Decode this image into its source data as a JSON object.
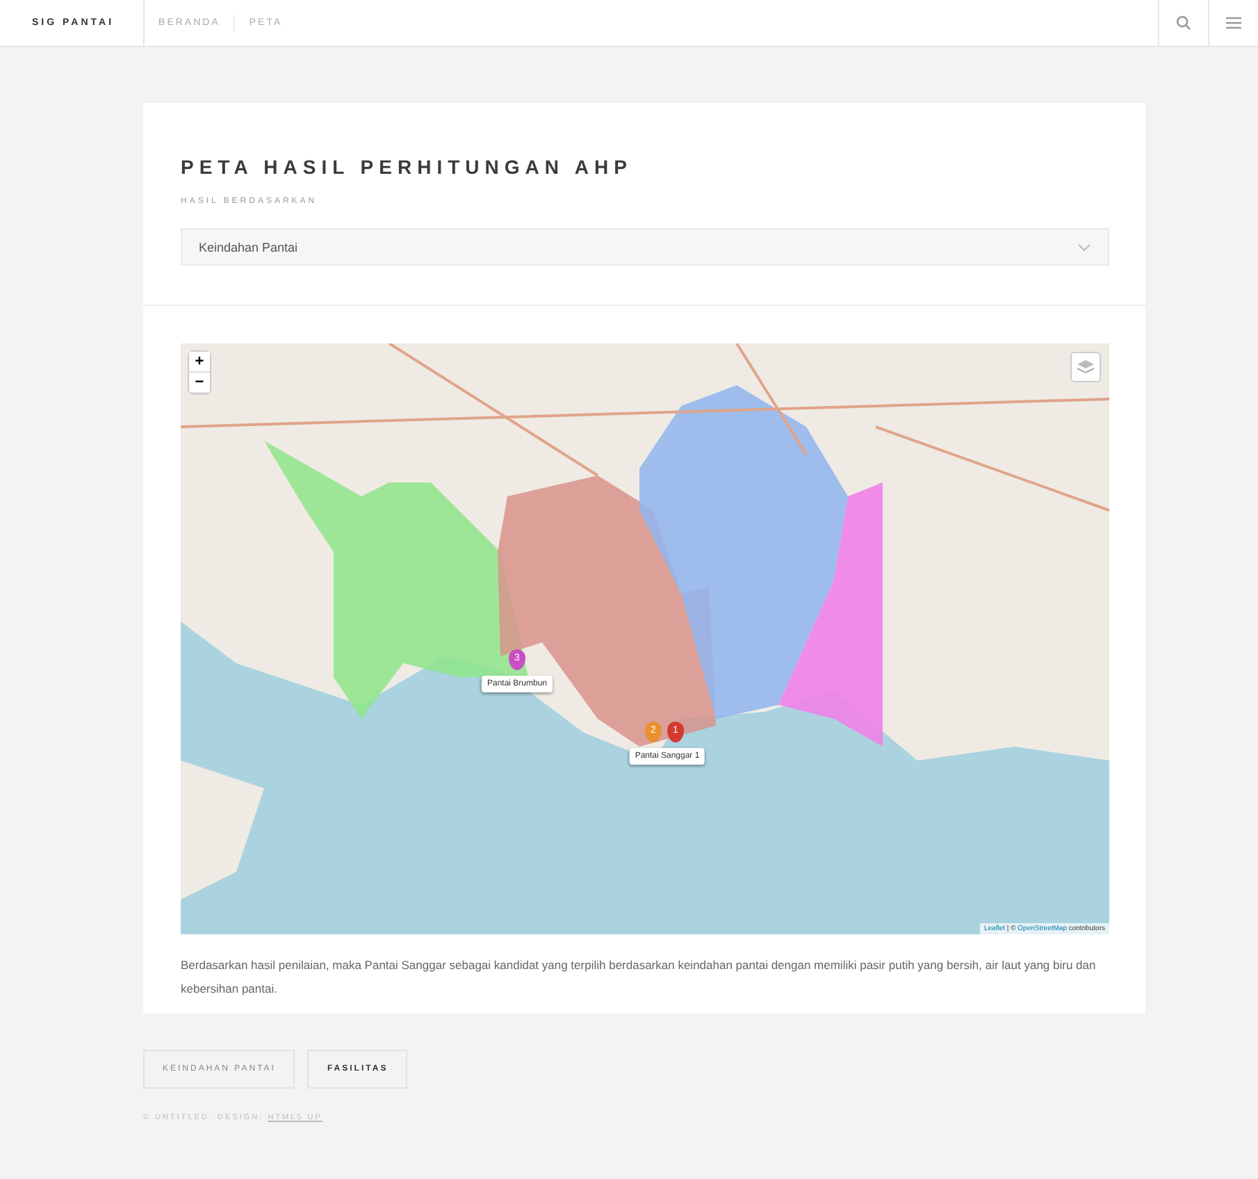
{
  "header": {
    "logo": "SIG PANTAI",
    "nav": [
      {
        "label": "BERANDA"
      },
      {
        "label": "PETA"
      }
    ]
  },
  "title": "PETA HASIL PERHITUNGAN AHP",
  "select_label": "HASIL BERDASARKAN",
  "select": {
    "value": "Keindahan Pantai"
  },
  "map": {
    "kind": "picture",
    "zoom_in": "+",
    "zoom_out": "−",
    "markers": [
      {
        "number": "3",
        "color": "#c94fc4",
        "label": "Pantai Brumbun"
      },
      {
        "number": "2",
        "color": "#e8912e"
      },
      {
        "number": "1",
        "color": "#d43a2f",
        "label": "Pantai Sanggar 1"
      }
    ],
    "attribution": {
      "leaflet": "Leaflet",
      "rest": "| ©",
      "osm": "OpenStreetMap",
      "contributors": "contributors"
    }
  },
  "description": "Berdasarkan hasil penilaian, maka Pantai Sanggar sebagai kandidat yang terpilih berdasarkan keindahan pantai dengan memiliki pasir putih yang bersih, air laut yang biru dan kebersihan pantai.",
  "buttons": [
    {
      "label": "KEINDAHAN PANTAI",
      "disabled": true
    },
    {
      "label": "FASILITAS",
      "disabled": false
    }
  ],
  "footer": {
    "text": "© UNTITLED. DESIGN:",
    "link": "HTML5 UP"
  }
}
